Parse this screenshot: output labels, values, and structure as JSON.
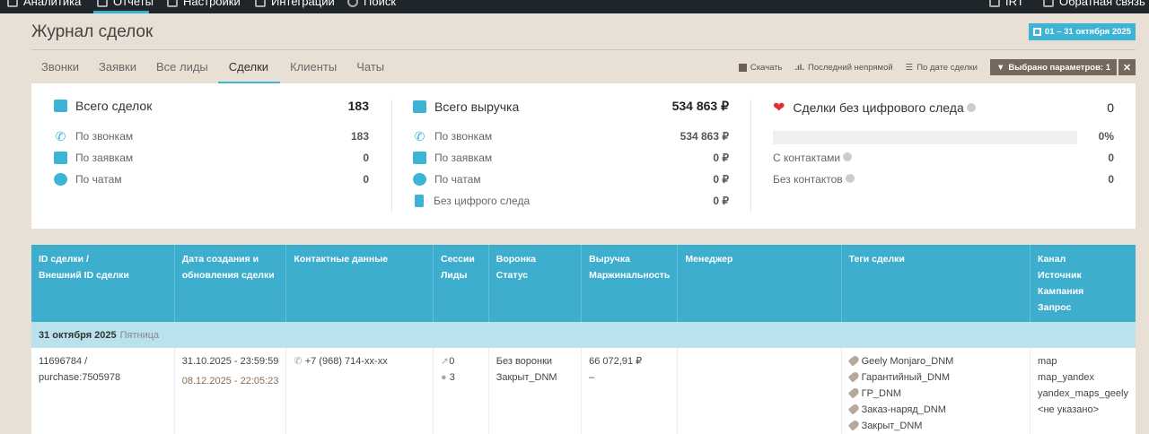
{
  "topnav": {
    "items": [
      "Аналитика",
      "Отчеты",
      "Настройки",
      "Интеграции",
      "Поиск"
    ],
    "right": [
      "IRT",
      "Обратная связь"
    ]
  },
  "page": {
    "title": "Журнал сделок",
    "date_range": "01 – 31 октября 2025"
  },
  "tabs": [
    "Звонки",
    "Заявки",
    "Все лиды",
    "Сделки",
    "Клиенты",
    "Чаты"
  ],
  "tools": {
    "download": "Скачать",
    "attribution": "Последний непрямой",
    "sort": "По дате сделки",
    "filter": "Выбрано параметров: 1",
    "close": "✕"
  },
  "stats": {
    "deals": {
      "title": "Всего сделок",
      "total": "183",
      "rows": [
        {
          "label": "По звонкам",
          "value": "183"
        },
        {
          "label": "По заявкам",
          "value": "0"
        },
        {
          "label": "По чатам",
          "value": "0"
        }
      ]
    },
    "revenue": {
      "title": "Всего выручка",
      "total": "534 863 ₽",
      "rows": [
        {
          "label": "По звонкам",
          "value": "534 863 ₽"
        },
        {
          "label": "По заявкам",
          "value": "0 ₽"
        },
        {
          "label": "По чатам",
          "value": "0 ₽"
        },
        {
          "label": "Без цифрого следа",
          "value": "0 ₽"
        }
      ]
    },
    "no_trace": {
      "title": "Сделки без цифрового следа",
      "total": "0",
      "percent": "0%",
      "progress": 0,
      "rows": [
        {
          "label": "С контактами",
          "value": "0"
        },
        {
          "label": "Без контактов",
          "value": "0"
        }
      ]
    }
  },
  "table": {
    "headers": [
      [
        "ID сделки /",
        "Внешний ID сделки"
      ],
      [
        "Дата создания и",
        "обновления сделки"
      ],
      [
        "Контактные данные"
      ],
      [
        "Сессии",
        "Лиды"
      ],
      [
        "Воронка",
        "Статус"
      ],
      [
        "Выручка",
        "Маржинальность"
      ],
      [
        "Менеджер"
      ],
      [
        "Теги сделки"
      ],
      [
        "Канал",
        "Источник",
        "Кампания",
        "Запрос"
      ]
    ],
    "group": {
      "date": "31 октября 2025",
      "weekday": "Пятница"
    },
    "rows": [
      {
        "id": "11696784 /",
        "ext_id": "purchase:7505978",
        "created": "31.10.2025 - 23:59:59",
        "updated": "08.12.2025 - 22:05:23",
        "phone": "+7 (968) 714-xx-xx",
        "sessions": "0",
        "leads": "3",
        "funnel": "Без воронки",
        "status": "Закрыт_DNM",
        "revenue": "66 072,91 ₽",
        "margin": "–",
        "manager": "",
        "tags": [
          "Geely Monjaro_DNM",
          "Гарантийный_DNM",
          "ГР_DNM",
          "Заказ-наряд_DNM",
          "Закрыт_DNM"
        ],
        "channel": "map",
        "source": "map_yandex",
        "campaign": "yandex_maps_geely",
        "query": "<не указано>"
      }
    ]
  }
}
